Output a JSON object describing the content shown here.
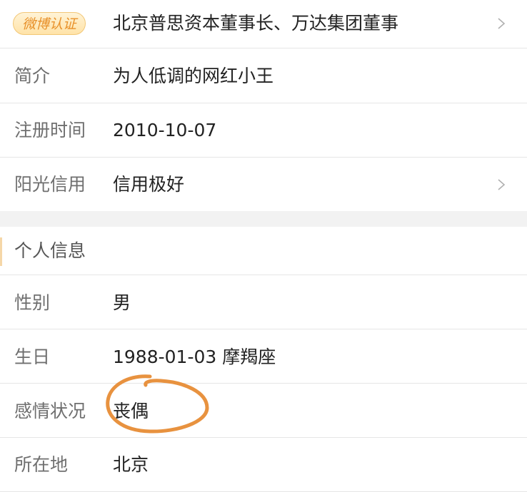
{
  "verified": {
    "badge": "微博认证",
    "value": "北京普思资本董事长、万达集团董事",
    "chevron_icon": "chevron-right-icon"
  },
  "bio": {
    "label": "简介",
    "value": "为人低调的网红小王"
  },
  "register_time": {
    "label": "注册时间",
    "value": "2010-10-07"
  },
  "credit": {
    "label": "阳光信用",
    "value": "信用极好",
    "chevron_icon": "chevron-right-icon"
  },
  "personal_info": {
    "section_title": "个人信息",
    "gender": {
      "label": "性别",
      "value": "男"
    },
    "birthday": {
      "label": "生日",
      "value": "1988-01-03  摩羯座"
    },
    "relationship": {
      "label": "感情状况",
      "value": "丧偶",
      "annotation_color": "#e8923f"
    },
    "location": {
      "label": "所在地",
      "value": "北京"
    }
  },
  "colors": {
    "badge_text": "#e8912a",
    "label_text": "#6f6f6f",
    "value_text": "#222222",
    "divider": "#e6e6e6",
    "section_gap": "#f2f2f2"
  }
}
